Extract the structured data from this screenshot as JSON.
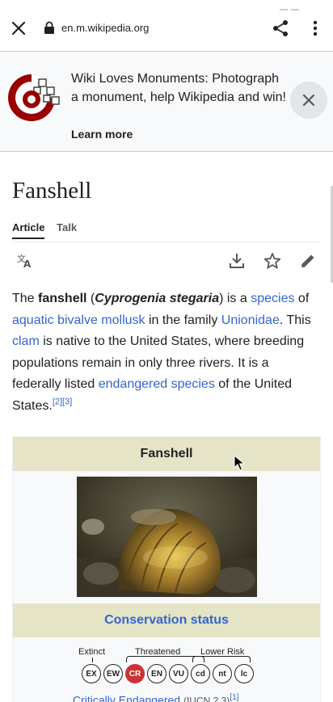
{
  "browser": {
    "url": "en.m.wikipedia.org"
  },
  "banner": {
    "message": "Wiki Loves Monuments: Photograph a monument, help Wikipedia and win!",
    "link_label": "Learn more"
  },
  "page": {
    "title": "Fanshell",
    "tabs": [
      {
        "label": "Article",
        "active": true
      },
      {
        "label": "Talk",
        "active": false
      }
    ]
  },
  "lead": {
    "t1": "The ",
    "bold1": "fanshell",
    "t2": " (",
    "bolditalic1": "Cyprogenia stegaria",
    "t3": ") is a ",
    "link_species": "species",
    "t4": " of ",
    "link_mollusk": "aquatic bivalve mollusk",
    "t5": " in the family ",
    "link_unionidae": "Unionidae",
    "t6": ". This ",
    "link_clam": "clam",
    "t7": " is native to the United States, where breeding populations remain in only three rivers. It is a federally listed ",
    "link_endangered": "endangered species",
    "t8": " of the United States.",
    "ref2": "[2]",
    "ref3": "[3]"
  },
  "infobox": {
    "title": "Fanshell",
    "section": "Conservation status",
    "labels": {
      "extinct": "Extinct",
      "threatened": "Threatened",
      "lower_risk": "Lower Risk"
    },
    "categories": [
      "EX",
      "EW",
      "CR",
      "EN",
      "VU",
      "cd",
      "nt",
      "lc"
    ],
    "active_category": "CR",
    "status_link": "Critically Endangered",
    "status_source": "(IUCN 2.3)",
    "status_ref": "[1]"
  },
  "colors": {
    "link": "#3366cc",
    "infobox_header": "#e5e4c6",
    "status_active": "#cc3333"
  }
}
